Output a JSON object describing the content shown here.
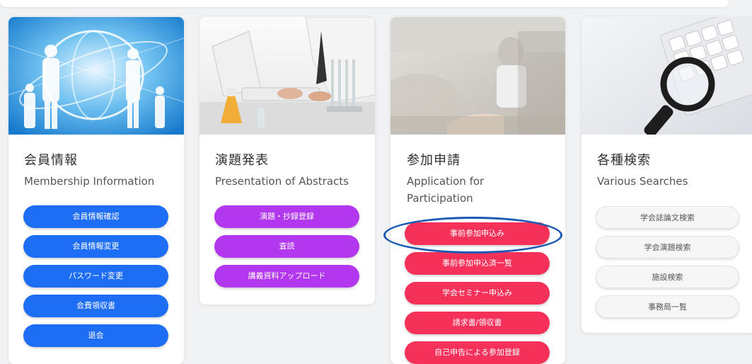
{
  "cards": [
    {
      "title": "会員情報",
      "subtitle": "Membership Information",
      "buttons": [
        "会員情報確認",
        "会員情報変更",
        "パスワード変更",
        "会費領収書",
        "退会"
      ]
    },
    {
      "title": "演題発表",
      "subtitle": "Presentation of Abstracts",
      "buttons": [
        "演題・抄録登録",
        "査読",
        "講義資料アップロード"
      ]
    },
    {
      "title": "参加申請",
      "subtitle_line1": "Application for",
      "subtitle_line2": "Participation",
      "buttons": [
        "事前参加申込み",
        "事前参加申込済一覧",
        "学会セミナー申込み",
        "請求書/領収書",
        "自己申告による参加登録"
      ]
    },
    {
      "title": "各種検索",
      "subtitle": "Various Searches",
      "buttons": [
        "学会誌論文検索",
        "学会演題検索",
        "施設検索",
        "事務局一覧"
      ]
    }
  ],
  "colors": {
    "membership": "#1e6ef5",
    "abstracts": "#b237ef",
    "participation": "#f5315a",
    "searches": "#f6f6f6",
    "highlight_ring": "#1a5ab4"
  },
  "images": {
    "membership": "globe-network-people-image",
    "abstracts": "laboratory-keyboard-image",
    "participation": "lecture-seminar-image",
    "searches": "magnifier-keyboard-image"
  },
  "annotation": {
    "highlighted_button": "事前参加申込み"
  }
}
